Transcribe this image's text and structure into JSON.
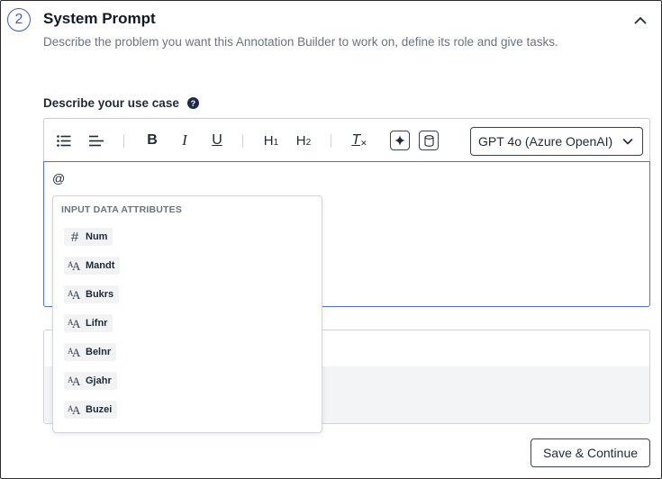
{
  "section": {
    "step_number": "2",
    "title": "System Prompt",
    "description": "Describe the problem you want this Annotation Builder to work on, define its role and give tasks.",
    "collapse_icon": "chevron-up-icon"
  },
  "field": {
    "label": "Describe your use case",
    "help_icon": "question-icon",
    "help_glyph": "?"
  },
  "toolbar": {
    "bullet_list_icon": "bullet-list-icon",
    "align_icon": "align-left-icon",
    "bold_label": "B",
    "italic_label": "I",
    "underline_label": "U",
    "h1_label": "H",
    "h1_sub": "1",
    "h2_label": "H",
    "h2_sub": "2",
    "clear_format_label": "T",
    "ai_icon": "sparkle-icon",
    "database_icon": "database-icon",
    "model_value": "GPT 4o (Azure OpenAI)"
  },
  "editor": {
    "content": "@"
  },
  "dropdown": {
    "header": "INPUT DATA ATTRIBUTES",
    "items": [
      {
        "label": "Num",
        "icon": "hash-icon",
        "glyph": "#"
      },
      {
        "label": "Mandt",
        "icon": "text-type-icon",
        "glyph_a": "A",
        "glyph_b": "A"
      },
      {
        "label": "Bukrs",
        "icon": "text-type-icon",
        "glyph_a": "A",
        "glyph_b": "A"
      },
      {
        "label": "Lifnr",
        "icon": "text-type-icon",
        "glyph_a": "A",
        "glyph_b": "A"
      },
      {
        "label": "Belnr",
        "icon": "text-type-icon",
        "glyph_a": "A",
        "glyph_b": "A"
      },
      {
        "label": "Gjahr",
        "icon": "text-type-icon",
        "glyph_a": "A",
        "glyph_b": "A"
      },
      {
        "label": "Buzei",
        "icon": "text-type-icon",
        "glyph_a": "A",
        "glyph_b": "A"
      }
    ]
  },
  "actions": {
    "save_label": "Save & Continue"
  },
  "colors": {
    "accent": "#3b5bdb",
    "editor_focus": "#4c6ef5",
    "dark_navy": "#1e2a4a"
  }
}
